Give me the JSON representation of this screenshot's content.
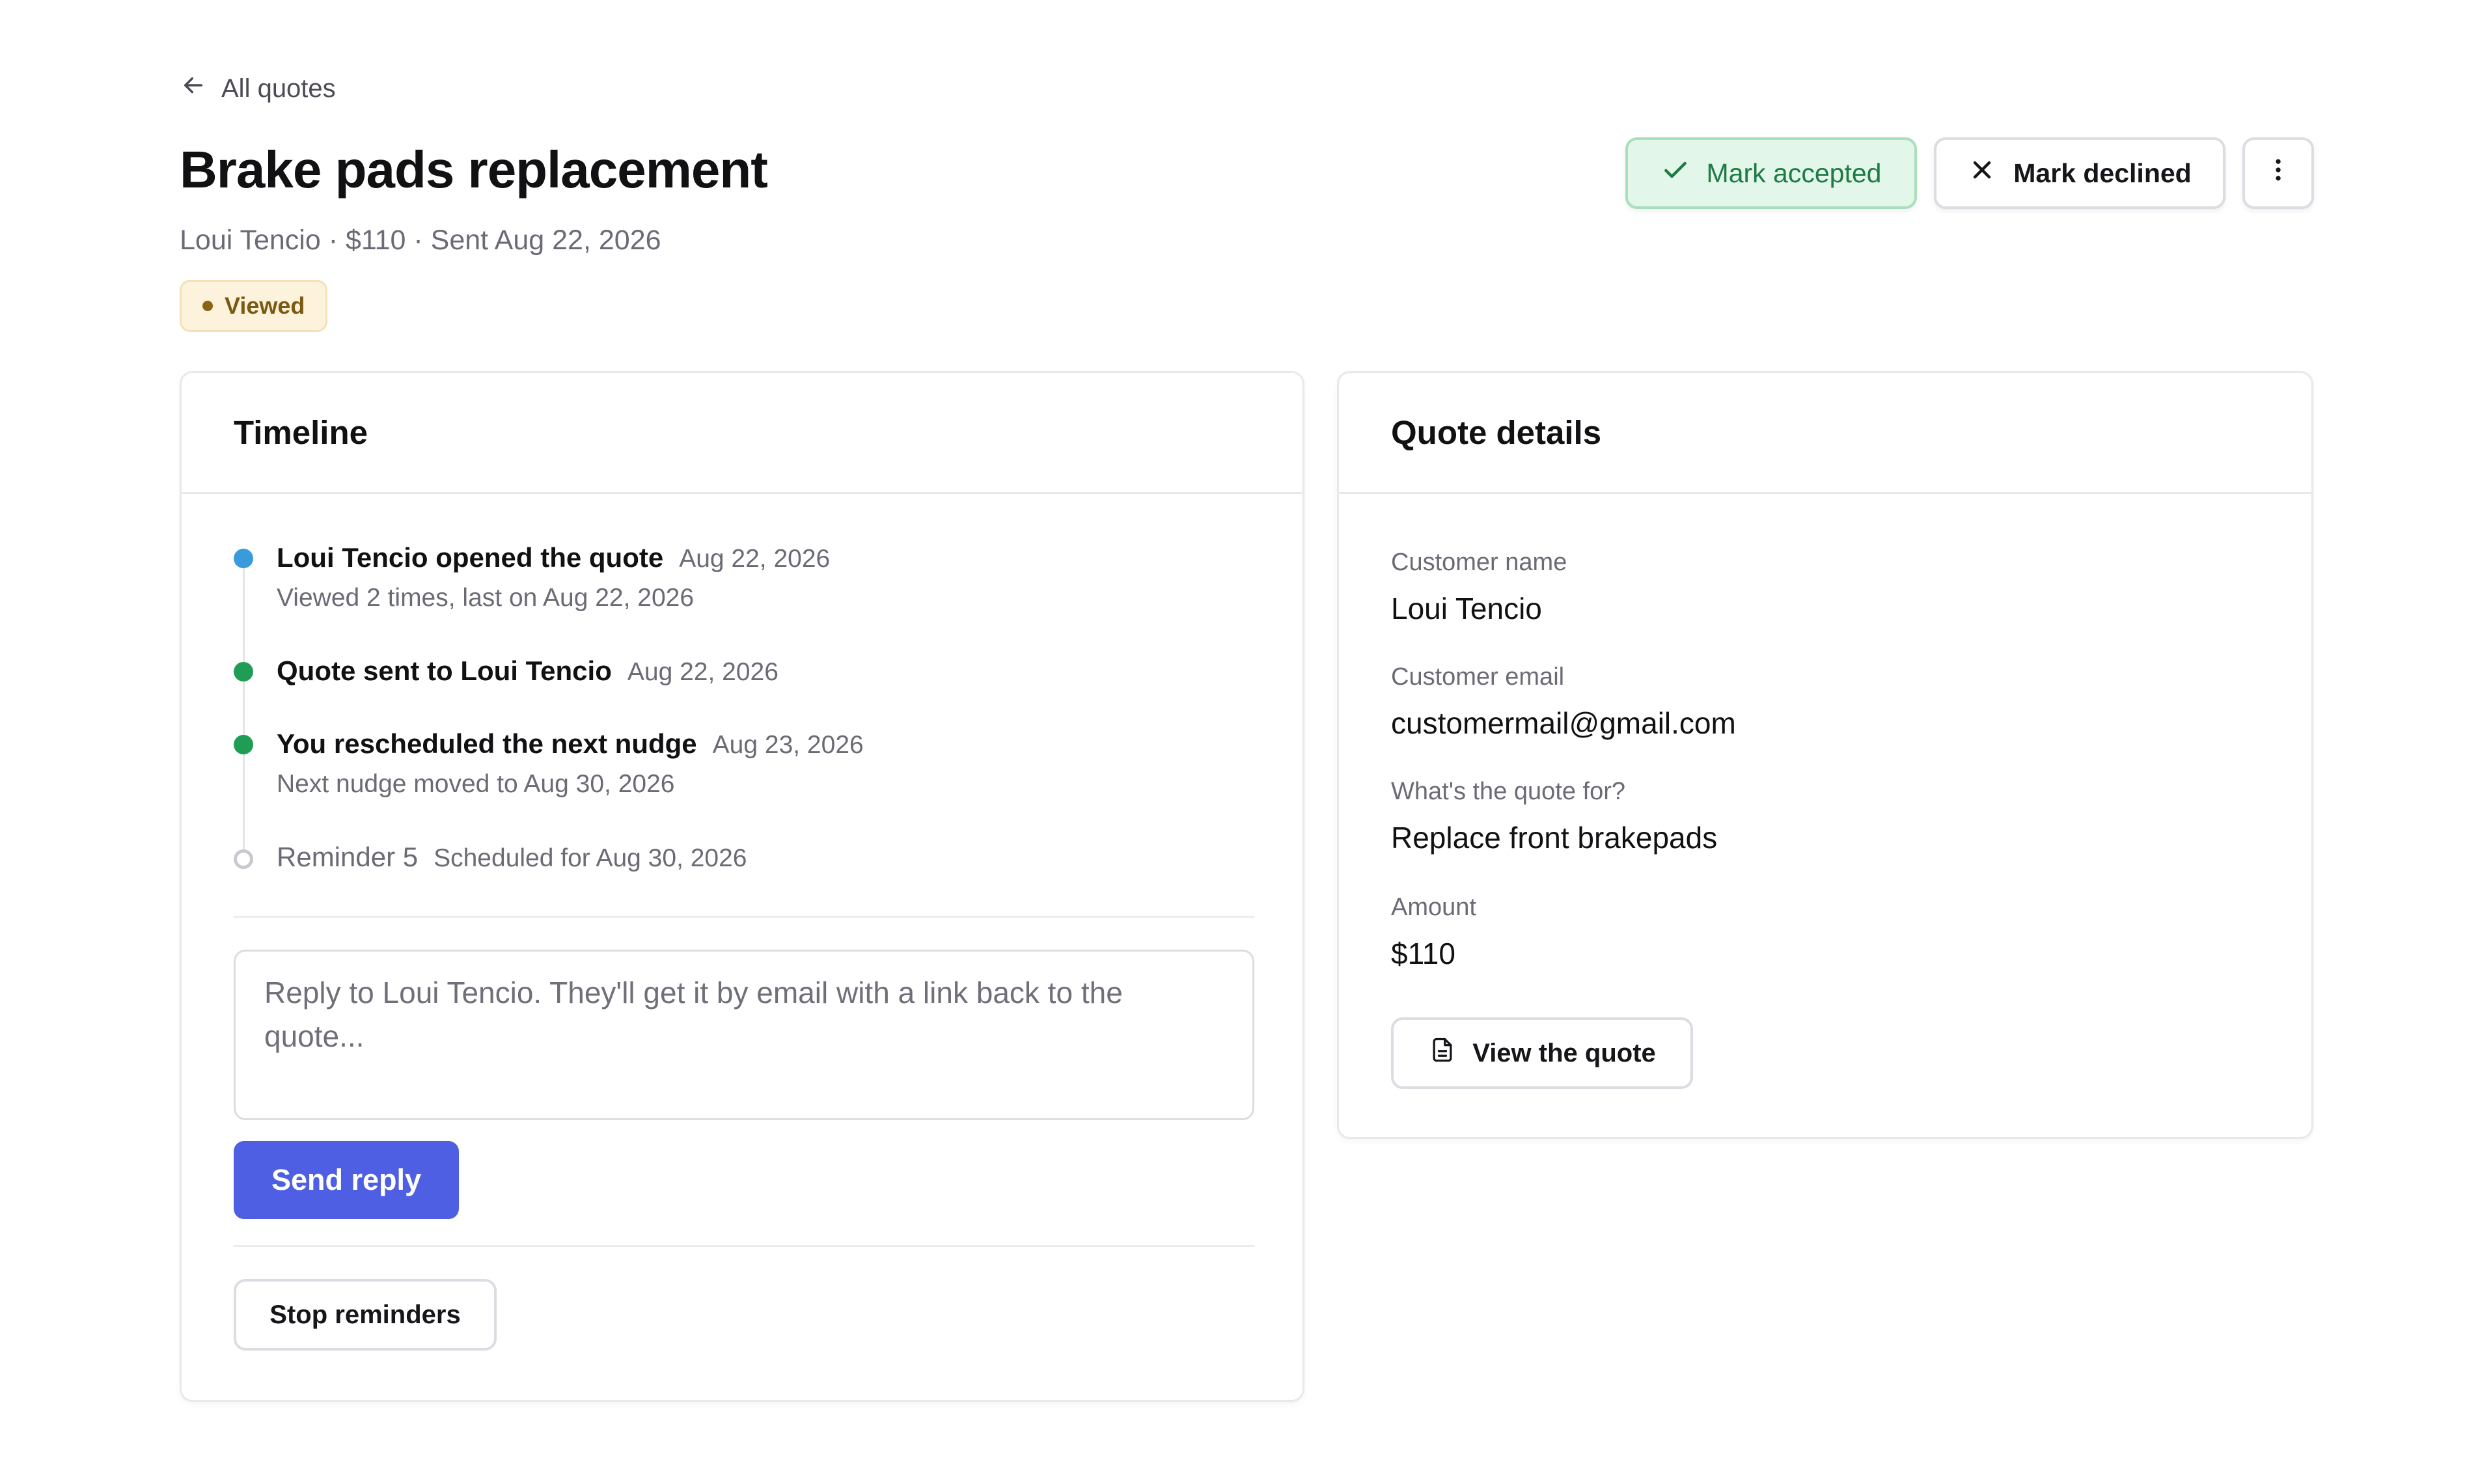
{
  "nav": {
    "back_label": "All quotes"
  },
  "header": {
    "title": "Brake pads replacement",
    "subtitle": "Loui Tencio · $110 · Sent Aug 22, 2026",
    "status": "Viewed"
  },
  "actions": {
    "accept_label": "Mark accepted",
    "decline_label": "Mark declined"
  },
  "timeline": {
    "title": "Timeline",
    "items": [
      {
        "title": "Loui Tencio opened the quote",
        "date": "Aug 22, 2026",
        "sub": "Viewed 2 times, last on Aug 22, 2026",
        "color": "#3a9bdc"
      },
      {
        "title": "Quote sent to Loui Tencio",
        "date": "Aug 22, 2026",
        "sub": "",
        "color": "#1f9d55"
      },
      {
        "title": "You rescheduled the next nudge",
        "date": "Aug 23, 2026",
        "sub": "Next nudge moved to Aug 30, 2026",
        "color": "#1f9d55"
      },
      {
        "title": "Reminder 5",
        "date": "Scheduled for Aug 30, 2026",
        "sub": "",
        "color": "#c8c8cf"
      }
    ],
    "reply_placeholder": "Reply to Loui Tencio. They'll get it by email with a link back to the quote...",
    "send_label": "Send reply",
    "stop_label": "Stop reminders"
  },
  "details": {
    "title": "Quote details",
    "fields": [
      {
        "label": "Customer name",
        "value": "Loui Tencio"
      },
      {
        "label": "Customer email",
        "value": "customermail@gmail.com"
      },
      {
        "label": "What's the quote for?",
        "value": "Replace front brakepads"
      },
      {
        "label": "Amount",
        "value": "$110"
      }
    ],
    "view_label": "View the quote"
  },
  "colors": {
    "accent": "#4f5fe3",
    "success": "#1d7b44",
    "status_viewed": "#7a5a12"
  },
  "icons": [
    "arrow-left-icon",
    "check-icon",
    "close-icon",
    "more-vertical-icon",
    "document-icon"
  ]
}
